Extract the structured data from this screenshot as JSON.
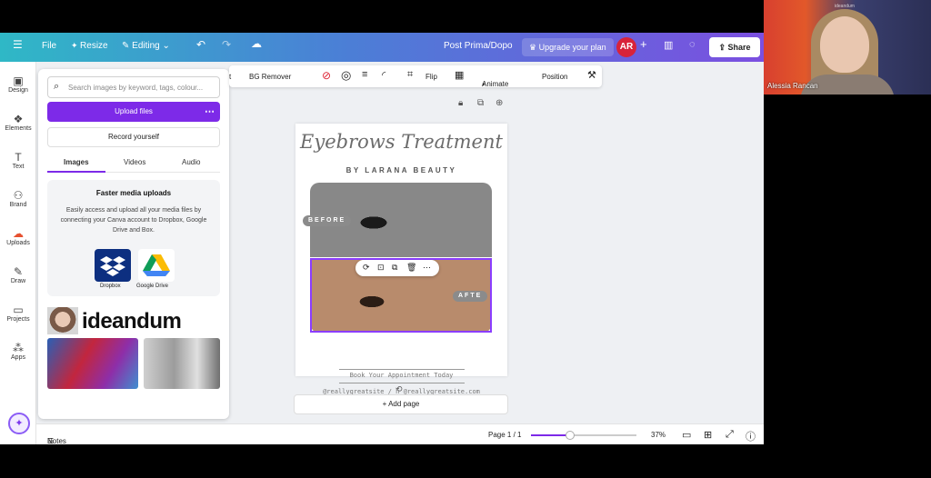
{
  "topbar": {
    "file": "File",
    "resize": "Resize",
    "editing": "Editing",
    "doc_title": "Post Prima/Dopo",
    "upgrade": "Upgrade your plan",
    "avatar": "AR",
    "share": "Share"
  },
  "rail": [
    {
      "label": "Design",
      "icon": "layout-icon"
    },
    {
      "label": "Elements",
      "icon": "shapes-icon"
    },
    {
      "label": "Text",
      "icon": "text-icon"
    },
    {
      "label": "Brand",
      "icon": "brand-icon"
    },
    {
      "label": "Uploads",
      "icon": "upload-cloud-icon"
    },
    {
      "label": "Draw",
      "icon": "pen-icon"
    },
    {
      "label": "Projects",
      "icon": "folder-icon"
    },
    {
      "label": "Apps",
      "icon": "apps-icon"
    }
  ],
  "panel": {
    "search_placeholder": "Search images by keyword, tags, colour...",
    "upload_files": "Upload files",
    "record": "Record yourself",
    "tabs": [
      "Images",
      "Videos",
      "Audio"
    ],
    "faster_title": "Faster media uploads",
    "faster_body": "Easily access and upload all your media files by connecting your Canva account to Dropbox, Google Drive and Box.",
    "dropbox": "Dropbox",
    "gdrive": "Google Drive",
    "thumb_logo_text": "ideandum"
  },
  "context_toolbar": {
    "t": "t",
    "bg_remover": "BG Remover",
    "flip": "Flip",
    "animate": "Animate",
    "position": "Position"
  },
  "design": {
    "title": "Eyebrows Treatment",
    "subtitle": "BY LARANA BEAUTY",
    "before": "BEFORE",
    "after": "AFTE",
    "appointment": "Book Your Appointment Today",
    "contact": "@reallygreatsite / h   @reallygreatsite.com"
  },
  "add_page": "+ Add page",
  "bottom": {
    "notes": "Notes",
    "page": "Page 1 / 1",
    "zoom": "37%",
    "zoom_fraction": 0.37
  },
  "webcam": {
    "name": "Alessia Rancan",
    "top_label": "ideandum"
  }
}
